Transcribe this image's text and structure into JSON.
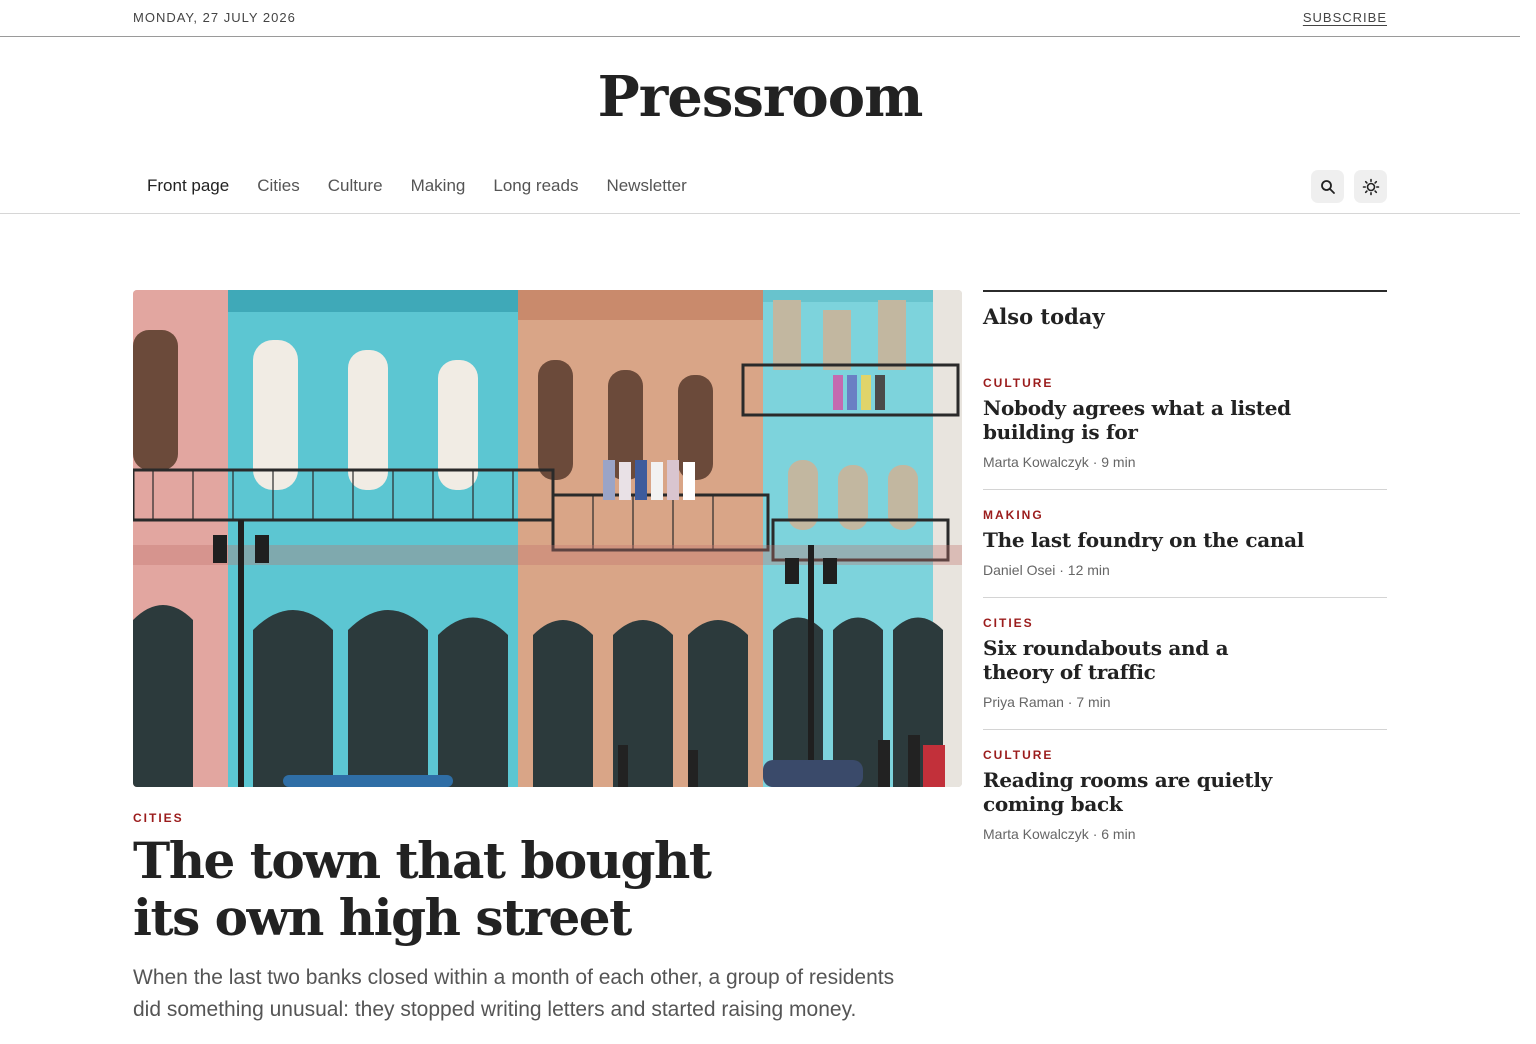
{
  "topbar": {
    "date": "MONDAY, 27 JULY 2026",
    "subscribe": "SUBSCRIBE"
  },
  "masthead": {
    "title": "Pressroom"
  },
  "nav": {
    "items": [
      "Front page",
      "Cities",
      "Culture",
      "Making",
      "Long reads",
      "Newsletter"
    ],
    "active": "Front page"
  },
  "tools": {
    "search_icon": "search-icon",
    "theme_icon": "sun-icon"
  },
  "hero": {
    "kicker": "CITIES",
    "title": "The town that bought its own high street",
    "dek": "When the last two banks closed within a month of each other, a group of residents did something unusual: they stopped writing letters and started raising money."
  },
  "sidebar": {
    "title": "Also today",
    "stories": [
      {
        "kicker": "CULTURE",
        "title": "Nobody agrees what a listed building is for",
        "byline": "Marta Kowalczyk · 9 min"
      },
      {
        "kicker": "MAKING",
        "title": "The last foundry on the canal",
        "byline": "Daniel Osei · 12 min"
      },
      {
        "kicker": "CITIES",
        "title": "Six roundabouts and a theory of traffic",
        "byline": "Priya Raman · 7 min"
      },
      {
        "kicker": "CULTURE",
        "title": "Reading rooms are quietly coming back",
        "byline": "Marta Kowalczyk · 6 min"
      }
    ]
  },
  "colors": {
    "accent": "#9b1c1c",
    "ink": "#222222",
    "muted": "#666666"
  }
}
